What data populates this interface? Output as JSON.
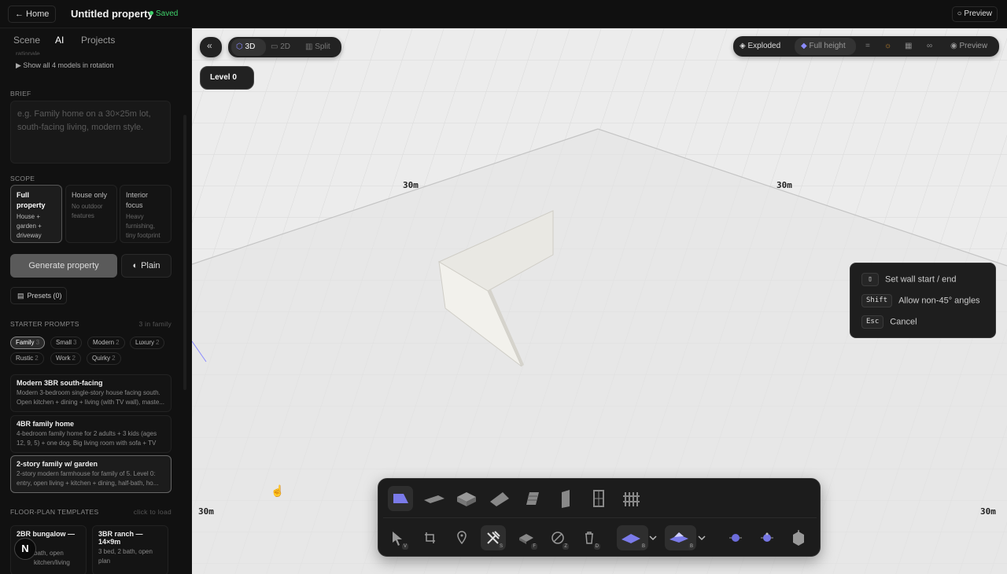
{
  "topbar": {
    "home_label": "← Home",
    "title": "Untitled property",
    "saved": "Saved",
    "preview": "○ Preview"
  },
  "sidebar": {
    "tabs": [
      "Scene",
      "AI",
      "Projects"
    ],
    "active_tab": "AI",
    "clipped_text": "rationale",
    "show_models": "▶ Show all 4 models in rotation",
    "brief_label": "BRIEF",
    "brief_placeholder": "e.g. Family home on a 30×25m lot, south-facing living, modern style.",
    "scope_label": "SCOPE",
    "scope_options": [
      {
        "title": "Full property",
        "sub": "House + garden + driveway",
        "active": true
      },
      {
        "title": "House only",
        "sub": "No outdoor features",
        "active": false
      },
      {
        "title": "Interior focus",
        "sub": "Heavy furnishing, tiny footprint",
        "active": false
      }
    ],
    "generate_label": "Generate property",
    "plain_label": "Plain",
    "presets_label": "Presets (0)",
    "starter_label": "STARTER PROMPTS",
    "starter_count": "3 in family",
    "chips": [
      {
        "label": "Family",
        "count": "3",
        "active": true
      },
      {
        "label": "Small",
        "count": "3",
        "active": false
      },
      {
        "label": "Modern",
        "count": "2",
        "active": false
      },
      {
        "label": "Luxury",
        "count": "2",
        "active": false
      },
      {
        "label": "Rustic",
        "count": "2",
        "active": false
      },
      {
        "label": "Work",
        "count": "2",
        "active": false
      },
      {
        "label": "Quirky",
        "count": "2",
        "active": false
      }
    ],
    "prompts": [
      {
        "title": "Modern 3BR south-facing",
        "desc": "Modern 3-bedroom single-story house facing south. Open kitchen + dining + living (with TV wall), maste..."
      },
      {
        "title": "4BR family home",
        "desc": "4-bedroom family home for 2 adults + 3 kids (ages 12, 9, 5) + one dog. Big living room with sofa + TV +..."
      },
      {
        "title": "2-story family w/ garden",
        "desc": "2-story modern farmhouse for family of 5. Level 0: entry, open living + kitchen + dining, half-bath, ho..."
      }
    ],
    "floorplan_label": "FLOOR-PLAN TEMPLATES",
    "floorplan_hint": "click to load",
    "templates": [
      {
        "title": "2BR bungalow —",
        "desc": "bath, open kitchen/living"
      },
      {
        "title": "3BR ranch — 14×9m",
        "desc": "3 bed, 2 bath, open plan"
      }
    ],
    "avatar_letter": "N"
  },
  "viewport": {
    "collapse_icon": "«",
    "view_modes": [
      "3D",
      "2D",
      "Split"
    ],
    "active_view": "3D",
    "level": "Level 0",
    "right_controls": {
      "exploded": "Exploded",
      "full_height": "Full height",
      "preview": "Preview"
    },
    "dimension_labels": [
      "30m",
      "30m",
      "30m",
      "30m"
    ],
    "hints": [
      {
        "key": "mouse-icon",
        "text": "Set wall start / end"
      },
      {
        "key": "Shift",
        "text": "Allow non-45° angles"
      },
      {
        "key": "Esc",
        "text": "Cancel"
      }
    ],
    "toolbar_badges": [
      "V",
      "S",
      "F",
      "Z",
      "D",
      "B",
      "B"
    ]
  }
}
